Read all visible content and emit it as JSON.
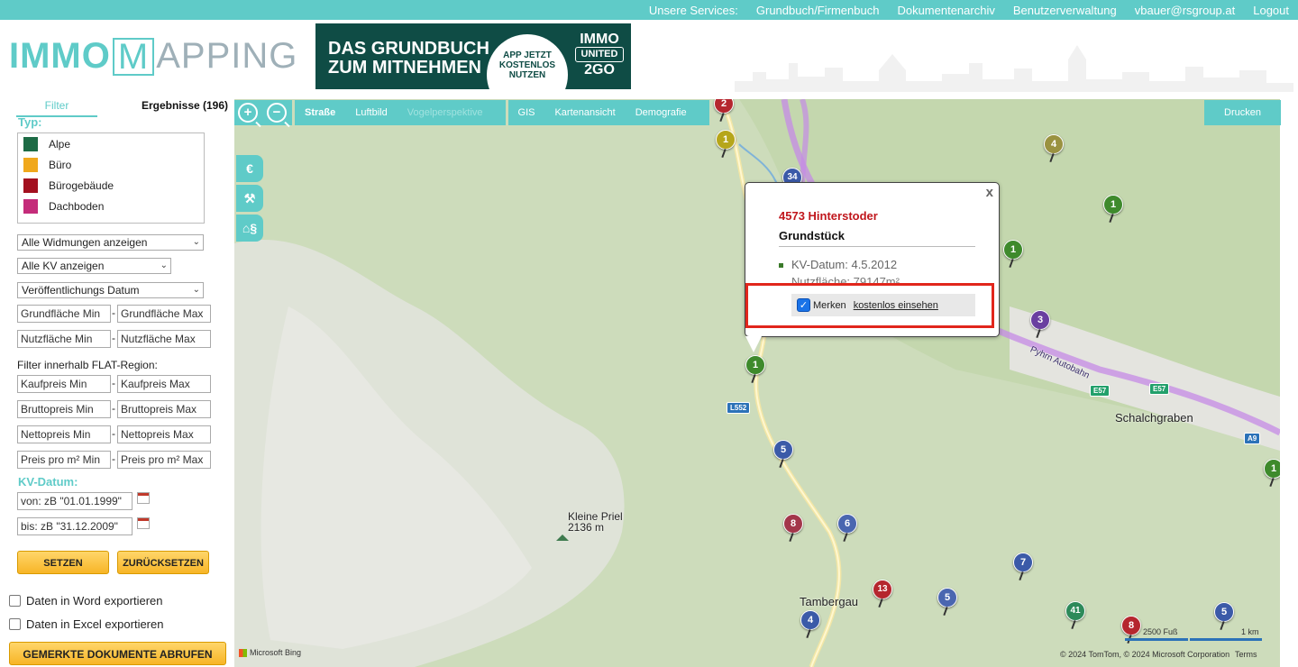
{
  "topbar": {
    "services_label": "Unsere Services:",
    "links": [
      "Grundbuch/Firmenbuch",
      "Dokumentenarchiv",
      "Benutzerverwaltung",
      "vbauer@rsgroup.at",
      "Logout"
    ]
  },
  "header": {
    "logo_part1": "IMMO",
    "logo_m": "M",
    "logo_part2": "APPING",
    "banner_line1": "DAS GRUNDBUCH",
    "banner_line2": "ZUM MITNEHMEN",
    "banner_circle": [
      "APP JETZT",
      "KOSTENLOS",
      "NUTZEN"
    ],
    "banner_brand": [
      "IMMO",
      "UNITED",
      "2GO"
    ]
  },
  "sidebar": {
    "tab_filter": "Filter",
    "tab_results": "Ergebnisse (196)",
    "type_title": "Typ:",
    "types": [
      {
        "label": "Alpe",
        "color": "#1d6b45"
      },
      {
        "label": "Büro",
        "color": "#f0a81c"
      },
      {
        "label": "Bürogebäude",
        "color": "#a3101f"
      },
      {
        "label": "Dachboden",
        "color": "#c42c7a"
      }
    ],
    "select_widmungen": "Alle Widmungen anzeigen",
    "select_kv": "Alle KV anzeigen",
    "select_datum": "Veröffentlichungs Datum",
    "grundflaeche_min": "Grundfläche Min",
    "grundflaeche_max": "Grundfläche Max",
    "nutzflaeche_min": "Nutzfläche Min",
    "nutzflaeche_max": "Nutzfläche Max",
    "flat_label": "Filter innerhalb FLAT-Region:",
    "kaufpreis_min": "Kaufpreis Min",
    "kaufpreis_max": "Kaufpreis Max",
    "bruttopreis_min": "Bruttopreis Min",
    "bruttopreis_max": "Bruttopreis Max",
    "nettopreis_min": "Nettopreis Min",
    "nettopreis_max": "Nettopreis Max",
    "preis_min": "Preis pro m² Min",
    "preis_max": "Preis pro m² Max",
    "kv_title": "KV-Datum:",
    "von_placeholder": "von: zB \"01.01.1999\"",
    "bis_placeholder": "bis: zB \"31.12.2009\"",
    "btn_setzen": "SETZEN",
    "btn_reset": "ZURÜCKSETZEN",
    "export_word": "Daten in Word exportieren",
    "export_excel": "Daten in Excel exportieren",
    "btn_gemerkte": "GEMERKTE DOKUMENTE ABRUFEN"
  },
  "map": {
    "toolbar": {
      "zoom_in": "+",
      "zoom_out": "−",
      "items_a": [
        "Straße",
        "Luftbild",
        "Vogelperspektive"
      ],
      "items_b": [
        "GIS",
        "Kartenansicht",
        "Demografie"
      ],
      "drucken": "Drucken"
    },
    "side_icons": [
      "€",
      "⚒",
      "⌂§"
    ],
    "popup": {
      "close": "x",
      "title": "4573 Hinterstoder",
      "subtitle": "Grundstück",
      "kv_datum": "KV-Datum: 4.5.2012",
      "nutzflaeche": "Nutzfläche: 79147m²",
      "merken": "Merken",
      "einsehen": "kostenlos einsehen"
    },
    "labels": {
      "kleine_priel": "Kleine Priel",
      "kleine_priel_alt": "2136 m",
      "schalchgraben": "Schalchgraben",
      "tambergau": "Tambergau",
      "pyhrn": "Pyhrn Autobahn",
      "l552": "L552",
      "e57a": "E57",
      "e57b": "E57",
      "a9": "A9",
      "bing": "Microsoft Bing",
      "scale_ft": "2500 Fuß",
      "scale_km": "1 km",
      "copyright": "© 2024 TomTom, © 2024 Microsoft Corporation",
      "terms": "Terms"
    },
    "pins": [
      {
        "n": "2",
        "color": "#b5262e"
      },
      {
        "n": "1",
        "color": "#b6a61a"
      },
      {
        "n": "4",
        "color": "#9a9240"
      },
      {
        "n": "34",
        "color": "#3b5aa8"
      },
      {
        "n": "1",
        "color": "#3e8a2c"
      },
      {
        "n": "1",
        "color": "#3e8a2c"
      },
      {
        "n": "3",
        "color": "#6a3fa0"
      },
      {
        "n": "1",
        "color": "#3e8a2c"
      },
      {
        "n": "5",
        "color": "#3b5aa8"
      },
      {
        "n": "8",
        "color": "#a3364a"
      },
      {
        "n": "6",
        "color": "#4a66b0"
      },
      {
        "n": "7",
        "color": "#3b5aa8"
      },
      {
        "n": "13",
        "color": "#b5262e"
      },
      {
        "n": "5",
        "color": "#4a66b0"
      },
      {
        "n": "4",
        "color": "#3b5aa8"
      },
      {
        "n": "41",
        "color": "#2d8a5a"
      },
      {
        "n": "8",
        "color": "#b5262e"
      },
      {
        "n": "5",
        "color": "#3b5aa8"
      },
      {
        "n": "1",
        "color": "#3e8a2c"
      }
    ]
  }
}
